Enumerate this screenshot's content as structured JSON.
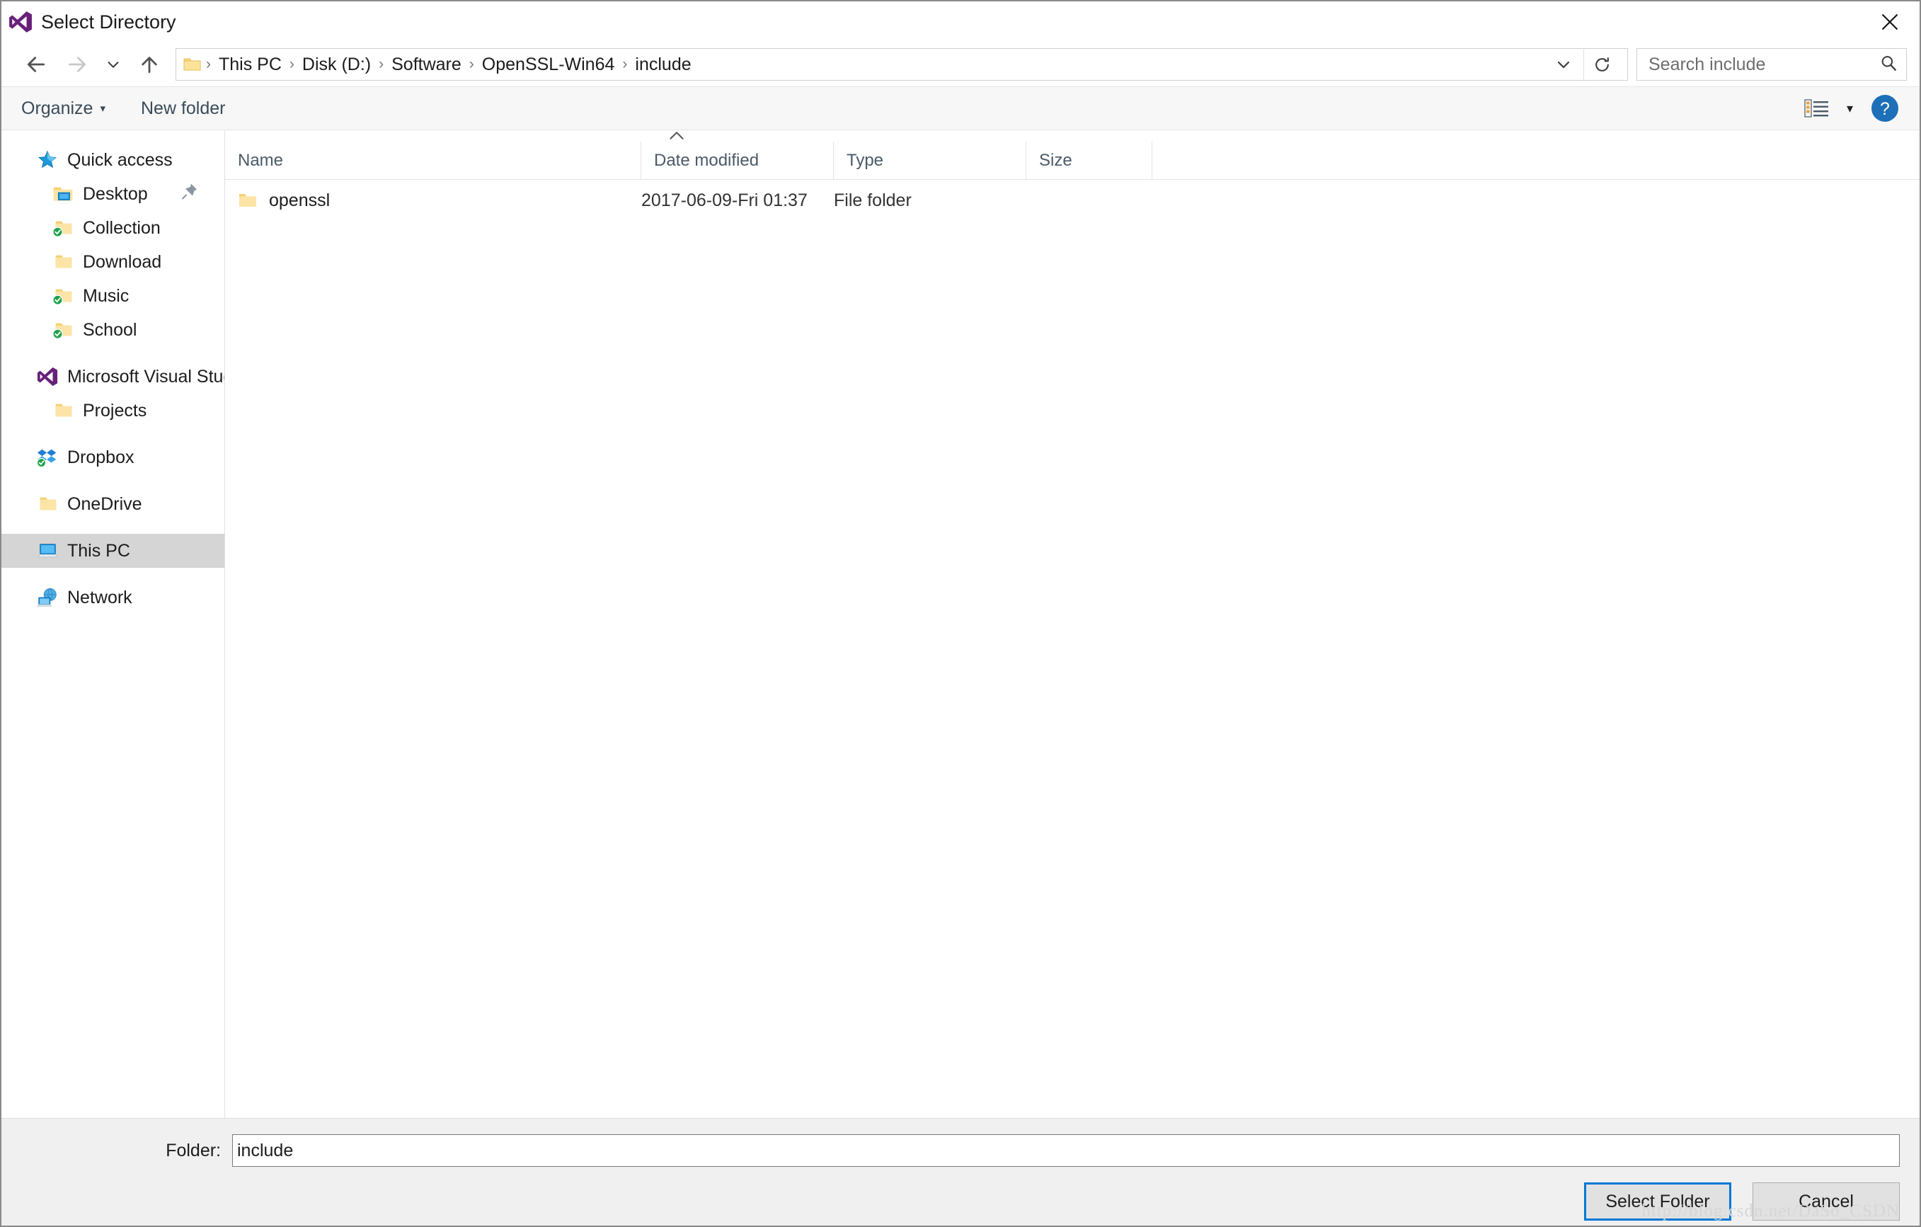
{
  "window": {
    "title": "Select Directory",
    "app_icon": "visual-studio-icon",
    "close_label": "✕"
  },
  "navigation": {
    "back_icon": "arrow-left-icon",
    "forward_icon": "arrow-right-icon",
    "recent_icon": "chevron-down-icon",
    "up_icon": "arrow-up-icon",
    "refresh_icon": "refresh-icon",
    "address_dropdown_icon": "chevron-down-icon"
  },
  "breadcrumb": {
    "folder_icon": "folder-icon",
    "separator": "›",
    "items": [
      {
        "label": "This PC"
      },
      {
        "label": "Disk (D:)"
      },
      {
        "label": "Software"
      },
      {
        "label": "OpenSSL-Win64"
      },
      {
        "label": "include"
      }
    ]
  },
  "search": {
    "placeholder": "Search include",
    "value": "",
    "icon": "search-icon"
  },
  "commandbar": {
    "organize_label": "Organize",
    "organize_caret": "▾",
    "new_folder_label": "New folder",
    "view_icon": "view-list-icon",
    "view_caret": "▾",
    "help_icon": "help-icon",
    "help_label": "?"
  },
  "sidebar": {
    "items": [
      {
        "label": "Quick access",
        "icon": "star-icon",
        "level": 0,
        "selected": false,
        "pinned": false
      },
      {
        "label": "Desktop",
        "icon": "folder-desktop-icon",
        "level": 1,
        "selected": false,
        "pinned": true
      },
      {
        "label": "Collection",
        "icon": "folder-sync-icon",
        "level": 1,
        "selected": false,
        "pinned": false
      },
      {
        "label": "Download",
        "icon": "folder-icon",
        "level": 1,
        "selected": false,
        "pinned": false
      },
      {
        "label": "Music",
        "icon": "folder-sync-icon",
        "level": 1,
        "selected": false,
        "pinned": false
      },
      {
        "label": "School",
        "icon": "folder-sync-icon",
        "level": 1,
        "selected": false,
        "pinned": false
      },
      {
        "label": "Microsoft Visual Stud",
        "icon": "visual-studio-icon",
        "level": 0,
        "selected": false,
        "pinned": false
      },
      {
        "label": "Projects",
        "icon": "folder-icon",
        "level": 1,
        "selected": false,
        "pinned": false
      },
      {
        "label": "Dropbox",
        "icon": "dropbox-icon",
        "level": 0,
        "selected": false,
        "pinned": false
      },
      {
        "label": "OneDrive",
        "icon": "folder-icon",
        "level": 0,
        "selected": false,
        "pinned": false
      },
      {
        "label": "This PC",
        "icon": "computer-icon",
        "level": 0,
        "selected": true,
        "pinned": false
      },
      {
        "label": "Network",
        "icon": "network-icon",
        "level": 0,
        "selected": false,
        "pinned": false
      }
    ]
  },
  "filelist": {
    "sort_indicator": "chevron-up-icon",
    "sort_column": "Name",
    "sort_direction": "ascending",
    "columns": [
      {
        "label": "Name"
      },
      {
        "label": "Date modified"
      },
      {
        "label": "Type"
      },
      {
        "label": "Size"
      }
    ],
    "rows": [
      {
        "icon": "folder-icon",
        "name": "openssl",
        "date_modified": "2017-06-09-Fri 01:37",
        "type": "File folder",
        "size": ""
      }
    ]
  },
  "footer": {
    "folder_label": "Folder:",
    "folder_value": "include",
    "folder_placeholder": "",
    "select_label": "Select Folder",
    "cancel_label": "Cancel",
    "watermark": "http://blog.csdn.net/DaSo_CSDN"
  },
  "colors": {
    "accent": "#0078d7",
    "selection": "#d5d5d5",
    "command_bar_bg": "#f7f7f7",
    "footer_bg": "#f0f0f0",
    "folder_yellow": "#fbd877",
    "vs_purple": "#68217a"
  }
}
